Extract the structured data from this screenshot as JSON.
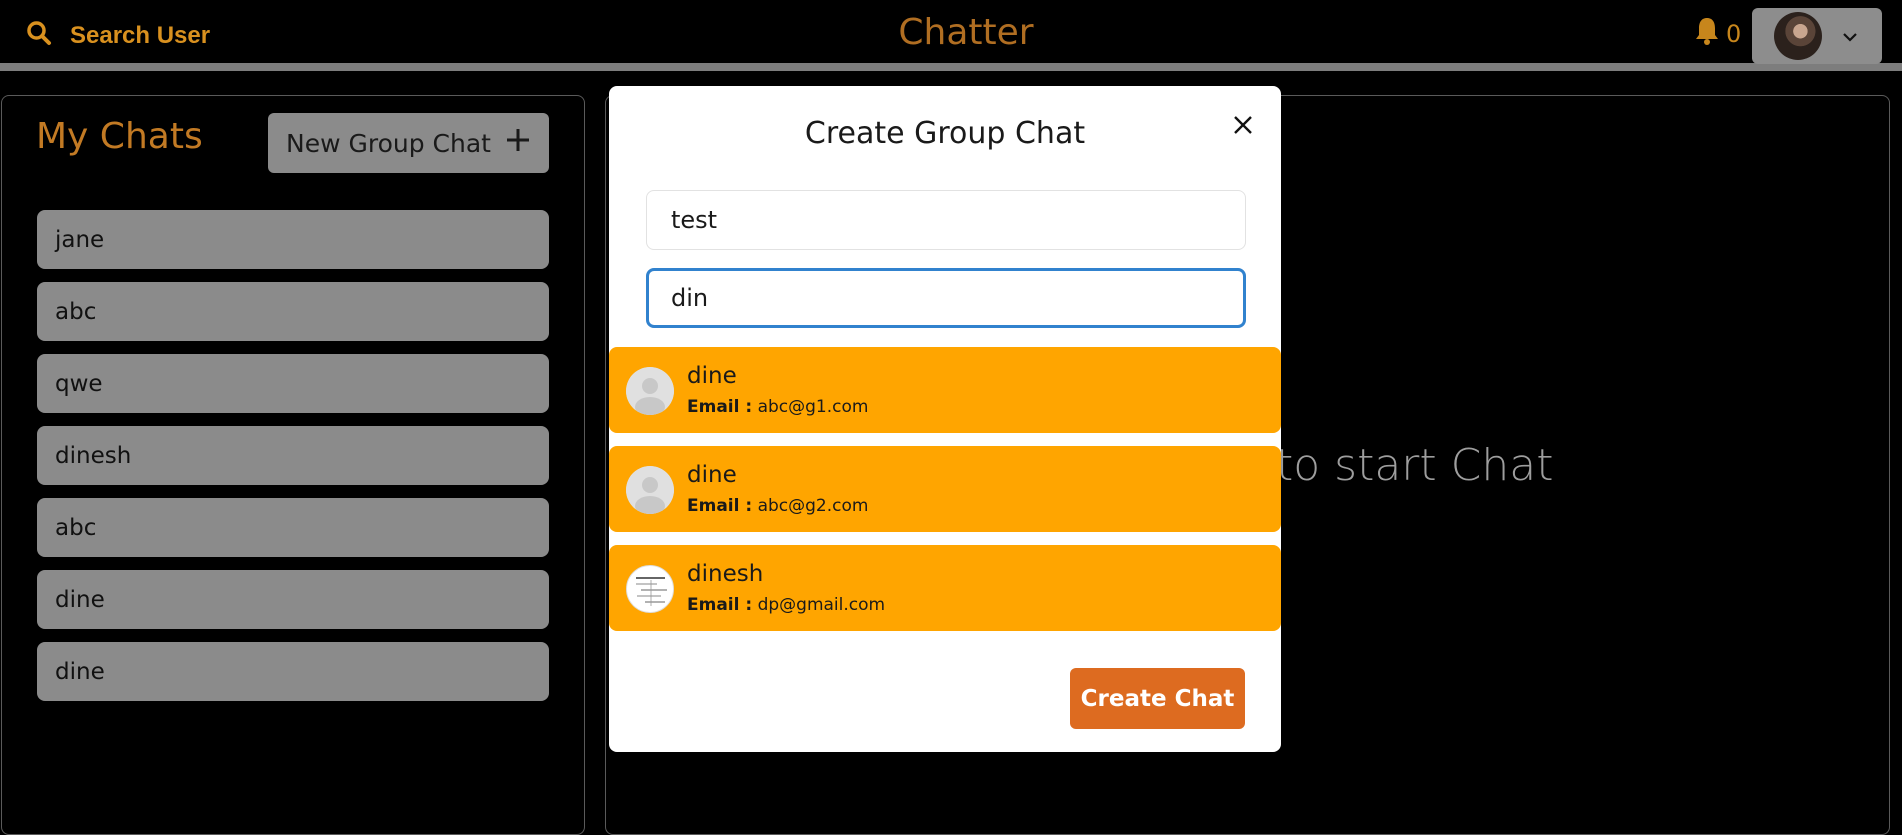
{
  "header": {
    "search_label": "Search User",
    "app_title": "Chatter",
    "notification_count": "0",
    "icons": {
      "search": "search-icon",
      "bell": "bell-icon",
      "chevron": "chevron-down-icon"
    }
  },
  "sidebar": {
    "title": "My Chats",
    "new_group_label": "New Group Chat",
    "chats": [
      {
        "label": "jane"
      },
      {
        "label": "abc"
      },
      {
        "label": "qwe"
      },
      {
        "label": "dinesh"
      },
      {
        "label": "abc"
      },
      {
        "label": "dine"
      },
      {
        "label": "dine"
      }
    ]
  },
  "main": {
    "placeholder_visible": "to start Chat"
  },
  "modal": {
    "title": "Create Group Chat",
    "chat_name_value": "test",
    "search_value": "din",
    "results": [
      {
        "name": "dine",
        "email_label": "Email :",
        "email": "abc@g1.com"
      },
      {
        "name": "dine",
        "email_label": "Email :",
        "email": "abc@g2.com"
      },
      {
        "name": "dinesh",
        "email_label": "Email :",
        "email": "dp@gmail.com"
      }
    ],
    "create_label": "Create Chat"
  },
  "colors": {
    "accent_orange": "#ffa500",
    "button_orange": "#dd6b20",
    "brand": "#b06e22",
    "focus_blue": "#3182ce",
    "panel_grey": "#8b8b8b"
  }
}
